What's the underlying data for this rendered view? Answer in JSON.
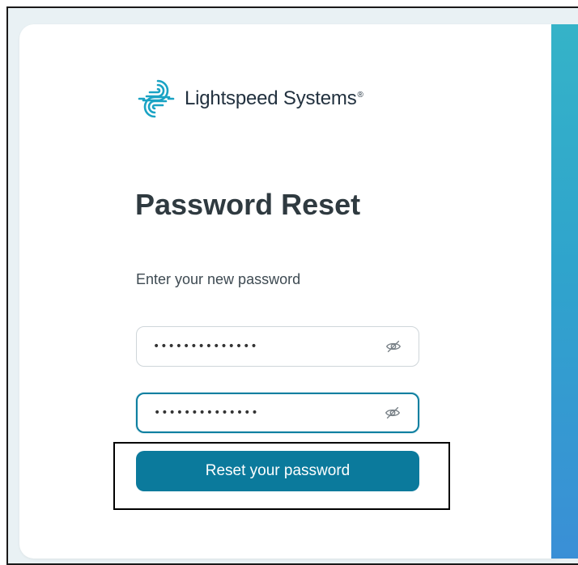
{
  "brand": {
    "logo_icon": "lightspeed-logo-icon",
    "name": "Lightspeed Systems",
    "registered_mark": "®",
    "text_color": "#22313f"
  },
  "form": {
    "title": "Password Reset",
    "instruction": "Enter your new password",
    "new_password": {
      "value": "••••••••••••••",
      "type": "password",
      "toggle_icon": "eye-slash-icon"
    },
    "confirm_password": {
      "value": "••••••••••••••",
      "type": "password",
      "toggle_icon": "eye-slash-icon",
      "focused": true
    },
    "submit_label": "Reset your password"
  },
  "colors": {
    "button": "#0b7a9c",
    "focus_border": "#0d7fa0",
    "side_panel_gradient": [
      "#35b3c8",
      "#3a8fd6"
    ]
  }
}
